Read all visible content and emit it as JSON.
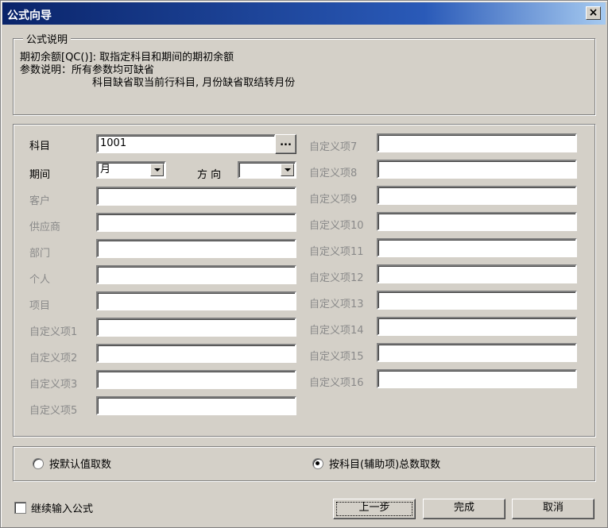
{
  "window": {
    "title": "公式向导",
    "close": "×"
  },
  "explain": {
    "legend": "公式说明",
    "line1": "期初余额[QC()]: 取指定科目和期间的期初余额",
    "line2": "参数说明：所有参数均可缺省",
    "line3": "科目缺省取当前行科目, 月份缺省取结转月份"
  },
  "form": {
    "subject": {
      "label": "科目",
      "value": "1001",
      "browse": "..."
    },
    "period": {
      "label": "期间",
      "value": "月"
    },
    "direction": {
      "label": "方 向",
      "value": ""
    },
    "left_fields": [
      "客户",
      "供应商",
      "部门",
      "个人",
      "项目",
      "自定义项1",
      "自定义项2",
      "自定义项3",
      "自定义项5"
    ],
    "right_fields": [
      "自定义项7",
      "自定义项8",
      "自定义项9",
      "自定义项10",
      "自定义项11",
      "自定义项12",
      "自定义项13",
      "自定义项14",
      "自定义项15",
      "自定义项16"
    ]
  },
  "options": {
    "radio_default": "按默认值取数",
    "radio_subject": "按科目(辅助项)总数取数",
    "selected": "radio_subject"
  },
  "footer": {
    "continue_label": "继续输入公式",
    "prev": "上一步",
    "finish": "完成",
    "cancel": "取消"
  }
}
